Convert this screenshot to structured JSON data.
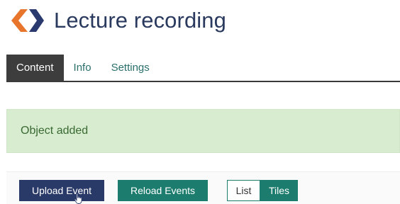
{
  "header": {
    "title": "Lecture recording",
    "logo_icon": "ilias-chevron-logo-icon",
    "logo_colors": {
      "orange": "#e8752c",
      "navy": "#2a3a6e"
    }
  },
  "tabs": [
    {
      "label": "Content",
      "active": true
    },
    {
      "label": "Info",
      "active": false
    },
    {
      "label": "Settings",
      "active": false
    }
  ],
  "alert": {
    "message": "Object added",
    "background": "#d8ecd0",
    "text_color": "#3a6a33"
  },
  "toolbar": {
    "upload_label": "Upload Event",
    "reload_label": "Reload Events",
    "view_list_label": "List",
    "view_tiles_label": "Tiles",
    "active_view": "Tiles"
  },
  "colors": {
    "primary_navy": "#2a3a68",
    "accent_teal": "#1c7d6e",
    "tab_active_bg": "#3d3d3d"
  },
  "cursor_icon": "hand-pointer-icon"
}
